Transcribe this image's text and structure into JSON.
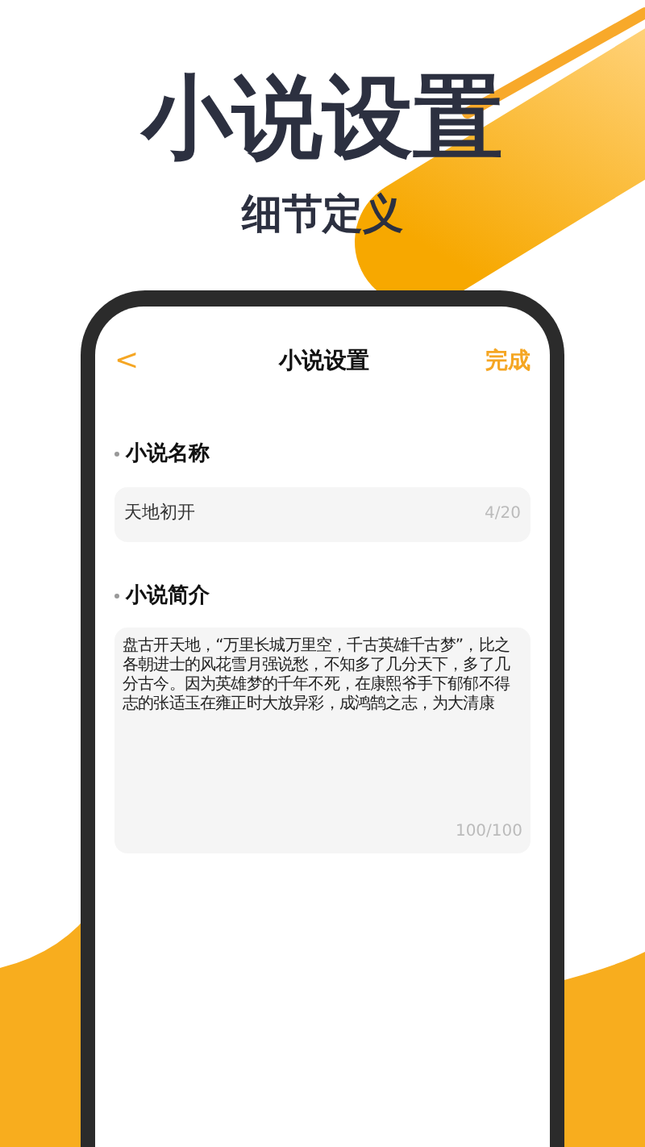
{
  "headline": "小说设置",
  "subheadline": "细节定义",
  "nav": {
    "back": "<",
    "title": "小说设置",
    "action": "完成"
  },
  "name_section": {
    "label": "小说名称",
    "value": "天地初开",
    "counter": "4/20"
  },
  "intro_section": {
    "label": "小说简介",
    "value": "盘古开天地，“万里长城万里空，千古英雄千古梦”，比之各朝进士的风花雪月强说愁，不知多了几分天下，多了几分古今。因为英雄梦的千年不死，在康熙爷手下郁郁不得志的张适玉在雍正时大放异彩，成鸿鹄之志，为大清康",
    "counter": "100/100"
  }
}
